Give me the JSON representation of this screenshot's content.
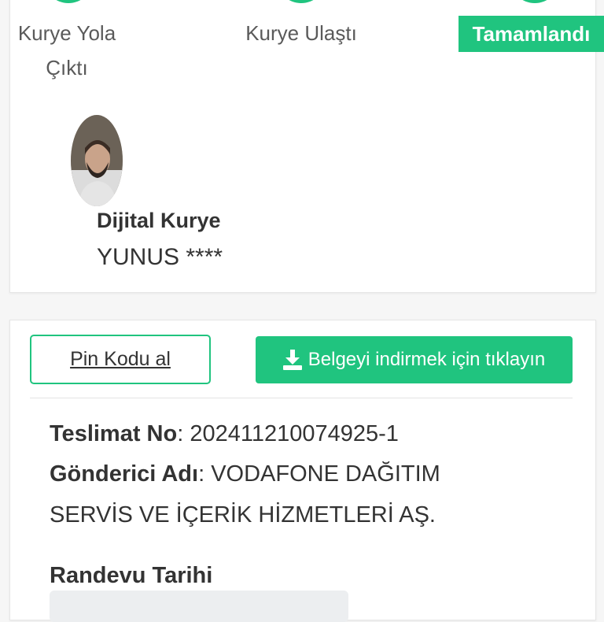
{
  "progress": {
    "steps": [
      {
        "label_line1": "Kurye Yola",
        "label_line2": "Çıktı"
      },
      {
        "label_line1": "Kurye Ulaştı"
      },
      {
        "label_line1": "Tamamlandı"
      }
    ],
    "accent_color": "#20c47f"
  },
  "courier": {
    "role": "Dijital Kurye",
    "name": "YUNUS ****"
  },
  "actions": {
    "pin_label": "Pin Kodu al",
    "download_label": "Belgeyi indirmek için tıklayın",
    "download_icon": "download-icon"
  },
  "delivery": {
    "no_label": "Teslimat No",
    "no_value": "20241121007492​5-1",
    "sender_label": "Gönderici Adı",
    "sender_value_line1": "VODAFONE DAĞITIM",
    "sender_value_line2": "SERVİS VE İÇERİK HİZMETLERİ AŞ.",
    "appointment_label": "Randevu Tarihi",
    "appointment_value": ""
  }
}
